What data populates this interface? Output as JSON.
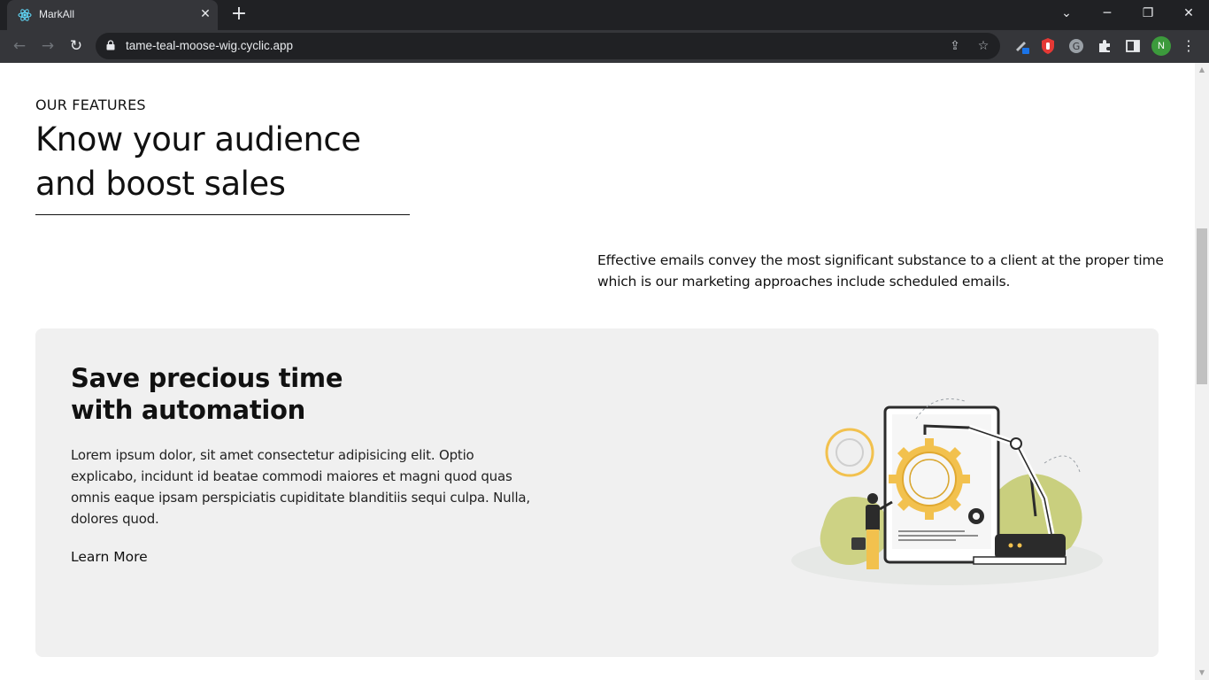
{
  "browser": {
    "tab_title": "MarkAll",
    "tab_close": "✕",
    "new_tab": "+",
    "url": "tame-teal-moose-wig.cyclic.app",
    "profile_initial": "N",
    "window_controls": {
      "minimize": "─",
      "restore": "❐",
      "close": "✕",
      "tab_search": "⌄"
    }
  },
  "features": {
    "eyebrow": "OUR FEATURES",
    "headline_line1": "Know your audience",
    "headline_line2": "and boost sales",
    "intro": "Effective emails convey the most significant substance to a client at the proper time which is our marketing approaches include scheduled emails."
  },
  "card": {
    "title_line1": "Save precious time",
    "title_line2": "with automation",
    "body": "Lorem ipsum dolor, sit amet consectetur adipisicing elit. Optio explicabo, incidunt id beatae commodi maiores et magni quod quas omnis eaque ipsam perspiciatis cupiditate blanditiis sequi culpa. Nulla, dolores quod.",
    "cta": "Learn More"
  },
  "colors": {
    "chrome_dark": "#202124",
    "chrome_tab": "#35363a",
    "card_bg": "#f0f0f0",
    "accent_yellow": "#f2c14e",
    "accent_olive": "#c9cf7e"
  }
}
